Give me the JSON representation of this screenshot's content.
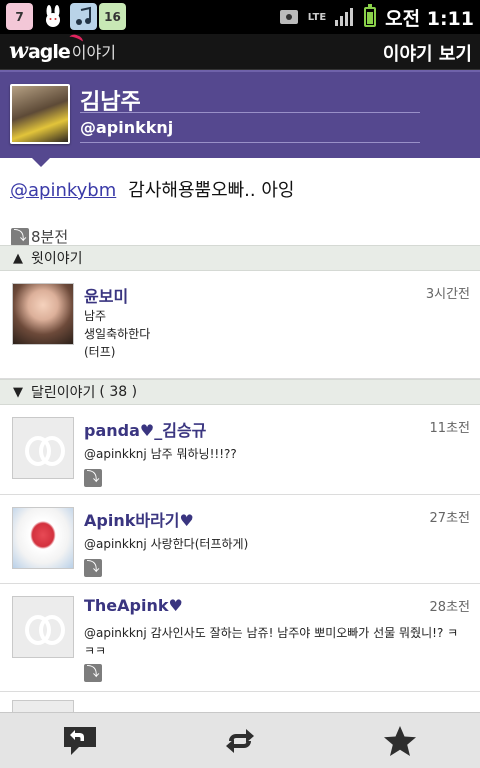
{
  "status_bar": {
    "app_icons": [
      {
        "icon": "calendar-icon",
        "label": "7",
        "bg": "#f3c7d7"
      },
      {
        "icon": "bunny-icon",
        "label": "",
        "bg": "#000000"
      },
      {
        "icon": "music-icon",
        "label": "",
        "bg": "#b9d3e8"
      },
      {
        "icon": "sports-icon",
        "label": "16",
        "bg": "#c8e8b5"
      }
    ],
    "network": "LTE",
    "time": "오전 1:11",
    "battery_level": 0.75
  },
  "app_bar": {
    "logo_brand": "agle",
    "logo_sub": "이야기",
    "title": "이야기 보기"
  },
  "profile": {
    "name": "김남주",
    "handle": "@apinkknj"
  },
  "post": {
    "mention": "@apinkybm",
    "text": "감사해용뿜오빠.. 아잉",
    "time": "8분전"
  },
  "parent_section": {
    "label": "윗이야기"
  },
  "parent_item": {
    "name": "윤보미",
    "time": "3시간전",
    "lines": [
      "남주",
      "생일축하한다",
      "(터프)"
    ]
  },
  "replies_section": {
    "label": "달린이야기",
    "count": "( 38 )"
  },
  "replies": [
    {
      "name": "panda♥_김승규",
      "time": "11초전",
      "text": "@apinkknj 남주 뭐하닝!!!??",
      "photo": "default"
    },
    {
      "name": "Apink바라기♥",
      "time": "27초전",
      "text": "@apinkknj 사랑한다(터프하게)",
      "photo": "cake"
    },
    {
      "name": "TheApink♥",
      "time": "28초전",
      "text": "@apinkknj 감사인사도 잘하는 남쥬! 남주야 뽀미오빠가 선물 뭐줬니!? ㅋㅋㅋ",
      "photo": "default"
    }
  ],
  "bottom_bar": {
    "actions": [
      "reply-icon",
      "retweet-icon",
      "star-icon"
    ]
  },
  "colors": {
    "accent": "#55488f",
    "link": "#3a3aa8"
  }
}
